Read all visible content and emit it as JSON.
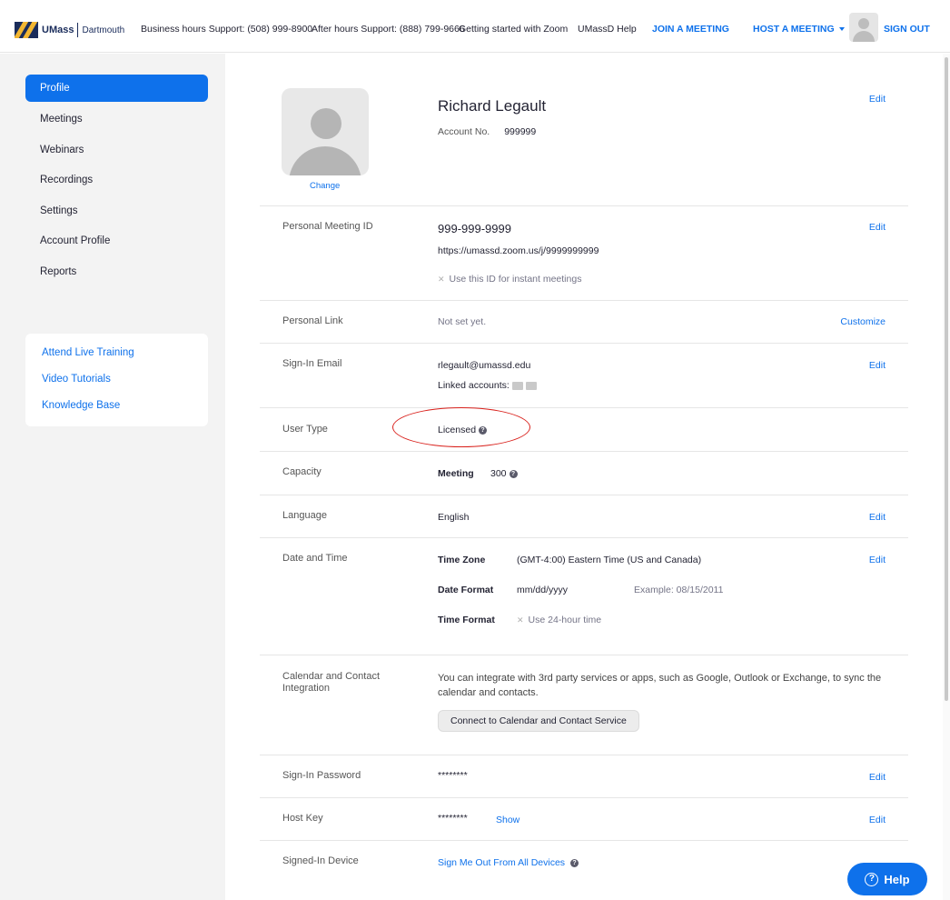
{
  "header": {
    "logo_name": "UMass",
    "logo_sub": "Dartmouth",
    "support_business": "Business hours Support: (508) 999-8900",
    "support_after": "After hours Support: (888) 799-9666",
    "getting_started": "Getting started with Zoom",
    "help": "UMassD Help",
    "join": "JOIN A MEETING",
    "host": "HOST A MEETING",
    "signout": "SIGN OUT"
  },
  "sidebar": {
    "items": [
      {
        "label": "Profile",
        "active": true
      },
      {
        "label": "Meetings"
      },
      {
        "label": "Webinars"
      },
      {
        "label": "Recordings"
      },
      {
        "label": "Settings"
      },
      {
        "label": "Account Profile"
      },
      {
        "label": "Reports"
      }
    ],
    "links": [
      "Attend Live Training",
      "Video Tutorials",
      "Knowledge Base"
    ]
  },
  "profile": {
    "change": "Change",
    "name": "Richard Legault",
    "account_label": "Account No.",
    "account_no": "999999",
    "edit": "Edit"
  },
  "pmi": {
    "label": "Personal Meeting ID",
    "id": "999-999-9999",
    "url": "https://umassd.zoom.us/j/9999999999",
    "instant": "Use this ID for instant meetings",
    "edit": "Edit"
  },
  "plink": {
    "label": "Personal Link",
    "value": "Not set yet.",
    "action": "Customize"
  },
  "email": {
    "label": "Sign-In Email",
    "value": "rlegault@umassd.edu",
    "linked": "Linked accounts:",
    "edit": "Edit"
  },
  "usertype": {
    "label": "User Type",
    "value": "Licensed",
    "highlight_color": "#d9211c"
  },
  "capacity": {
    "label": "Capacity",
    "key": "Meeting",
    "value": "300"
  },
  "language": {
    "label": "Language",
    "value": "English",
    "edit": "Edit"
  },
  "datetime": {
    "label": "Date and Time",
    "tz_label": "Time Zone",
    "tz_value": "(GMT-4:00) Eastern Time (US and Canada)",
    "df_label": "Date Format",
    "df_value": "mm/dd/yyyy",
    "df_example": "Example: 08/15/2011",
    "tf_label": "Time Format",
    "tf_value": "Use 24-hour time",
    "edit": "Edit"
  },
  "calendar": {
    "label": "Calendar and Contact Integration",
    "desc_line1": "You can integrate with 3rd party services or apps, such as Google, Outlook or Exchange, to sync the",
    "desc_line2": "calendar and contacts.",
    "button": "Connect to Calendar and Contact Service"
  },
  "password": {
    "label": "Sign-In Password",
    "value": "********",
    "edit": "Edit"
  },
  "hostkey": {
    "label": "Host Key",
    "value": "********",
    "show": "Show",
    "edit": "Edit"
  },
  "device": {
    "label": "Signed-In Device",
    "action": "Sign Me Out From All Devices"
  },
  "help_button": "Help",
  "colors": {
    "accent": "#0e71eb",
    "brand_navy": "#1a2c5b",
    "brand_gold": "#f2b632"
  }
}
